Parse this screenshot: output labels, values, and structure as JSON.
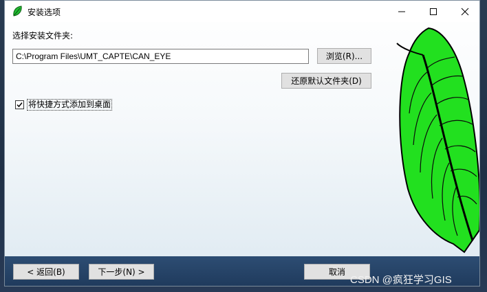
{
  "window": {
    "title": "安装选项"
  },
  "folder": {
    "label": "选择安装文件夹:",
    "path_value": "C:\\Program Files\\UMT_CAPTE\\CAN_EYE",
    "browse_label": "浏览(R)...",
    "restore_label": "还原默认文件夹(D)"
  },
  "shortcut": {
    "label": "将快捷方式添加到桌面",
    "checked": true
  },
  "nav": {
    "back_label": "< 返回(B)",
    "next_label": "下一步(N) >",
    "cancel_label": "取消"
  },
  "watermark": "CSDN @疯狂学习GIS",
  "icons": [
    "leaf-icon",
    "minimize-icon",
    "maximize-icon",
    "close-icon",
    "checkmark-icon"
  ],
  "colors": {
    "leaf_green": "#22dd22",
    "bottom_bar": "#1f3a5c",
    "button_face": "#e1e1e1"
  }
}
